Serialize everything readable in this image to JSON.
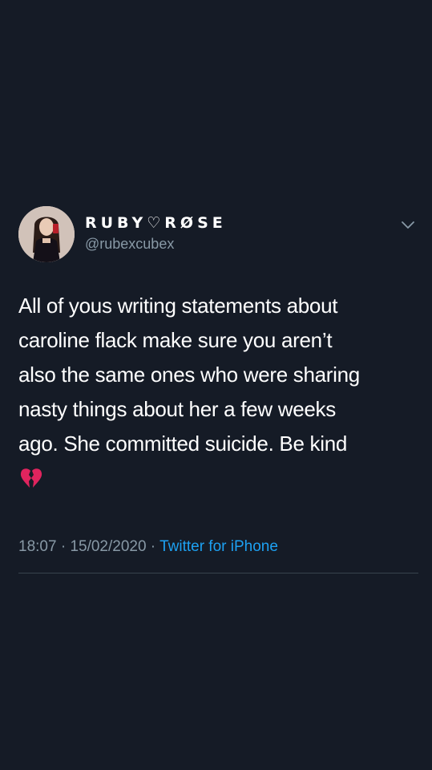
{
  "tweet": {
    "author": {
      "display_name": "RUBY♡RØSE",
      "handle": "@rubexcubex",
      "avatar_icon": "profile-photo"
    },
    "menu_icon": "chevron-down-icon",
    "text_lines": [
      "All of yous writing statements about",
      "caroline flack make sure you aren’t",
      "also the same ones who were sharing",
      "nasty things about her a few weeks",
      "ago. She committed suicide. Be kind"
    ],
    "emoji": "💔",
    "emoji_icon": "broken-heart-icon",
    "time": "18:07",
    "separator": " · ",
    "date": "15/02/2020",
    "source": "Twitter for iPhone"
  },
  "colors": {
    "background": "#151b26",
    "secondary_text": "#8899a6",
    "link": "#1da1f2",
    "divider": "#38444d",
    "heart": "#e0245e"
  }
}
